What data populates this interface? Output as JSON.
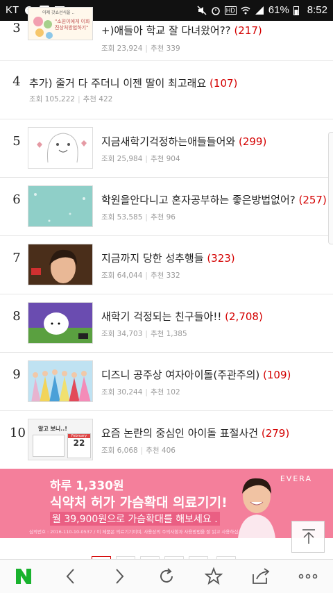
{
  "statusbar": {
    "carrier": "KT",
    "battery": "61%",
    "time": "8:52"
  },
  "items": [
    {
      "rank": "3",
      "title": "+)애들아 학교 잘 다녀왔어??",
      "comments": "(217)",
      "views": "조회 23,924",
      "recs": "추천 339",
      "thumb_caption": "이제 갓쇼선식을 ..",
      "thumb_text": "\"소원이에게 이화진상처방법하기\""
    },
    {
      "rank": "4",
      "title": "추가) 줄거 다 주더니 이젠 딸이 최고래요",
      "comments": "(107)",
      "views": "조회 105,222",
      "recs": "추천 422"
    },
    {
      "rank": "5",
      "title": "지금새학기걱정하는애들들어와",
      "comments": "(299)",
      "views": "조회 25,984",
      "recs": "추천 904"
    },
    {
      "rank": "6",
      "title": "학원을안다니고 혼자공부하는 좋은방법없어?",
      "comments": "(257)",
      "views": "조회 53,585",
      "recs": "추천 96"
    },
    {
      "rank": "7",
      "title": "지금까지 당한 성추행들",
      "comments": "(323)",
      "views": "조회 64,044",
      "recs": "추천 332"
    },
    {
      "rank": "8",
      "title": "새학기 걱정되는 친구들아!!",
      "comments": "(2,708)",
      "views": "조회 34,703",
      "recs": "추천 1,385"
    },
    {
      "rank": "9",
      "title": "디즈니 공주상 여자아이돌(주관주의)",
      "comments": "(109)",
      "views": "조회 30,244",
      "recs": "추천 102"
    },
    {
      "rank": "10",
      "title": "요즘 논란의 중심인 아이돌 표절사건",
      "comments": "(279)",
      "views": "조회 6,068",
      "recs": "추천 406",
      "thumb_caption": "알고 보니..!",
      "thumb_date": "22",
      "thumb_month": "February"
    }
  ],
  "ad": {
    "line1": "하루 1,330원",
    "line2": "식약처 허가 가슴확대 의료기기!",
    "line3": "월 39,900원으로 가슴확대를 해보세요 .",
    "line4": "심의번호 : 2016-110-10-0537 / 이 제품은 의료기기이며, 사용상의 주의사항과 사용방법을 잘 읽고 사용하십시오.",
    "brand": "EVERA"
  },
  "colors": {
    "accent_red": "#d40000",
    "ad_pink": "#f47f9b",
    "naver_green": "#19b22e"
  },
  "icons": {
    "bottom": [
      "naver-icon",
      "back-icon",
      "forward-icon",
      "reload-icon",
      "bookmark-star-icon",
      "share-icon",
      "more-icon"
    ],
    "scroll": "arrow-up-icon"
  }
}
